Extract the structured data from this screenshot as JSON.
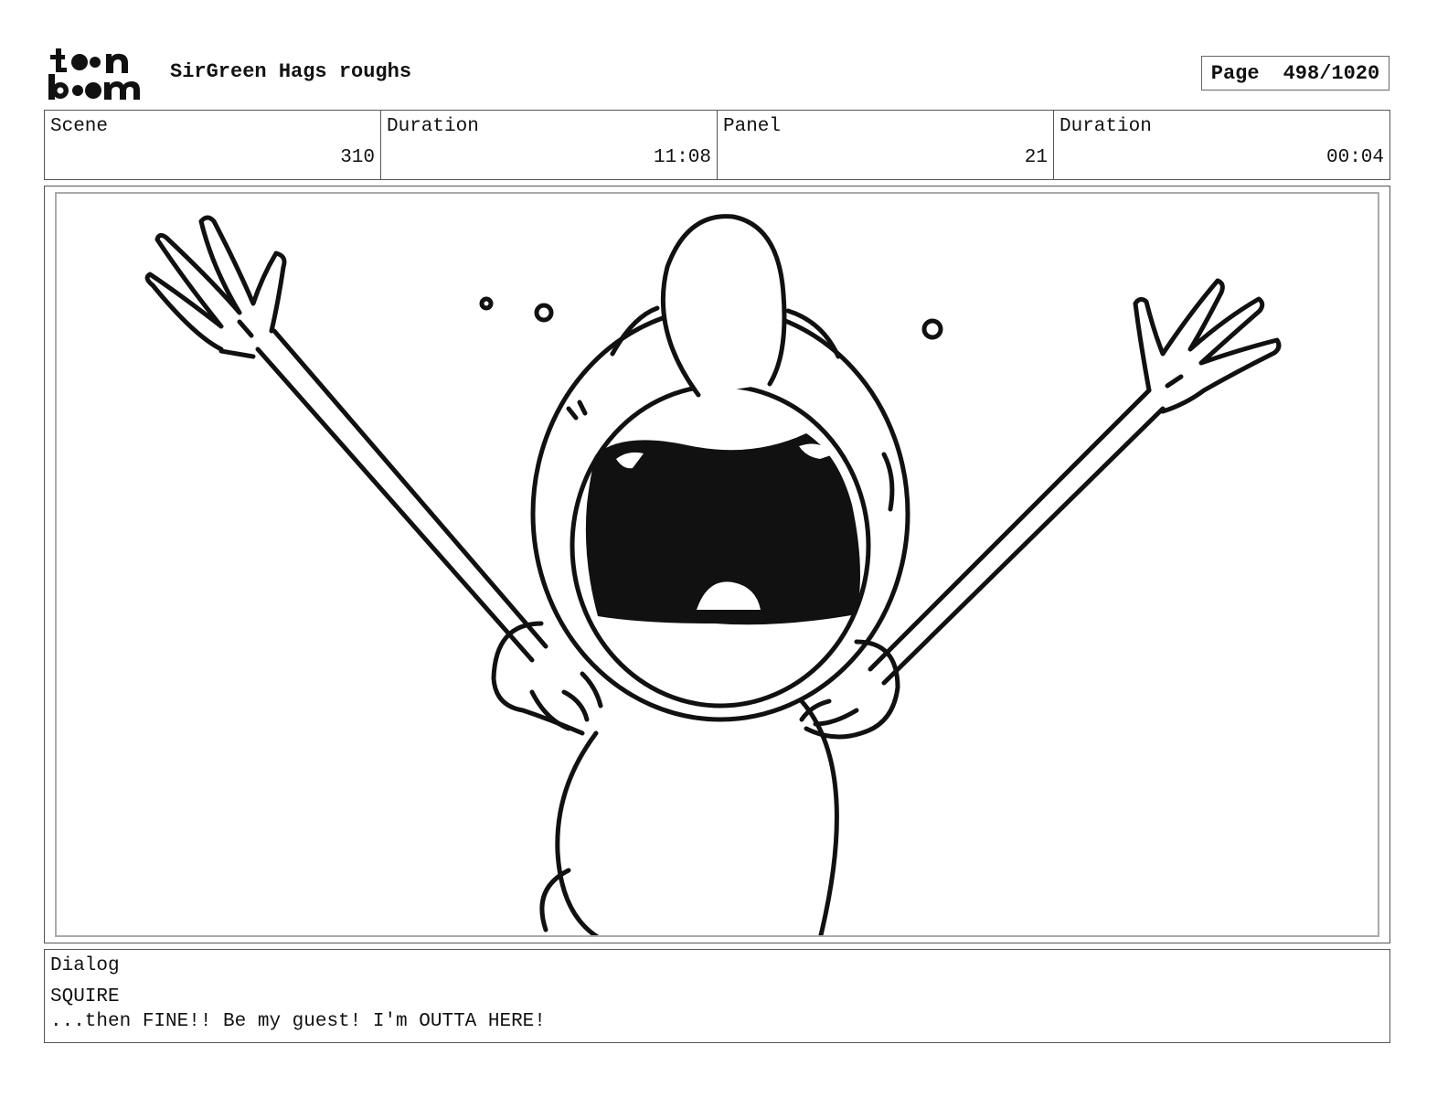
{
  "header": {
    "logo_text": "toon boom",
    "project_title": "SirGreen Hags roughs",
    "page_label": "Page",
    "page_number": "498/1020"
  },
  "info": {
    "scene_label": "Scene",
    "scene_value": "310",
    "scene_duration_label": "Duration",
    "scene_duration_value": "11:08",
    "panel_label": "Panel",
    "panel_value": "21",
    "panel_duration_label": "Duration",
    "panel_duration_value": "00:04"
  },
  "dialog": {
    "label": "Dialog",
    "speaker": "SQUIRE",
    "line": "...then FINE!! Be my guest! I'm OUTTA HERE!"
  }
}
